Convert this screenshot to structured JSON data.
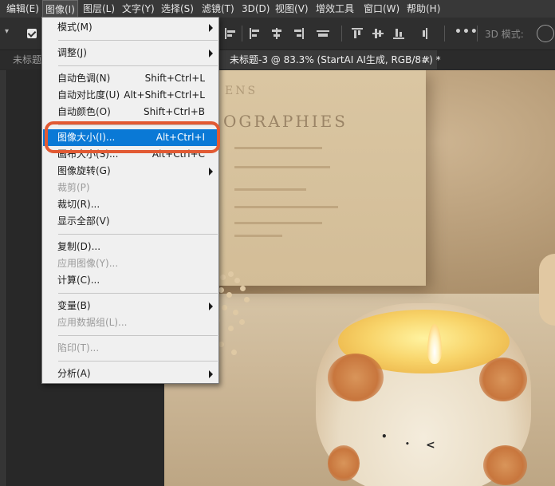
{
  "menubar": {
    "items": [
      "编辑(E)",
      "图像(I)",
      "图层(L)",
      "文字(Y)",
      "选择(S)",
      "滤镜(T)",
      "3D(D)",
      "视图(V)",
      "增效工具",
      "窗口(W)",
      "帮助(H)"
    ]
  },
  "options_bar": {
    "mode_3d_label": "3D 模式:"
  },
  "tabs": [
    {
      "label": "未标题"
    },
    {
      "label": "未标题-3 @ 83.3% (StartAI AI生成, RGB/8#) *",
      "close": "×"
    }
  ],
  "image_menu": {
    "groups": [
      [
        {
          "label": "模式(M)",
          "submenu": true
        },
        {
          "label": "调整(J)",
          "submenu": true
        }
      ],
      [
        {
          "label": "自动色调(N)",
          "shortcut": "Shift+Ctrl+L"
        },
        {
          "label": "自动对比度(U)",
          "shortcut": "Alt+Shift+Ctrl+L"
        },
        {
          "label": "自动颜色(O)",
          "shortcut": "Shift+Ctrl+B"
        }
      ],
      [
        {
          "label": "图像大小(I)...",
          "shortcut": "Alt+Ctrl+I",
          "highlighted": true
        },
        {
          "label": "画布大小(S)...",
          "shortcut": "Alt+Ctrl+C"
        },
        {
          "label": "图像旋转(G)",
          "submenu": true
        },
        {
          "label": "裁剪(P)",
          "disabled": true
        },
        {
          "label": "裁切(R)..."
        },
        {
          "label": "显示全部(V)"
        }
      ],
      [
        {
          "label": "复制(D)..."
        },
        {
          "label": "应用图像(Y)...",
          "disabled": true
        },
        {
          "label": "计算(C)..."
        }
      ],
      [
        {
          "label": "变量(B)",
          "submenu": true
        },
        {
          "label": "应用数据组(L)...",
          "disabled": true
        }
      ],
      [
        {
          "label": "陷印(T)...",
          "disabled": true
        }
      ],
      [
        {
          "label": "分析(A)",
          "submenu": true
        }
      ]
    ]
  },
  "canvas_image": {
    "poster_text": [
      "ENS",
      "OGRAPHIES"
    ],
    "colors": {
      "highlight": "#0a79d6",
      "annotation_ring": "#e25a33"
    }
  }
}
